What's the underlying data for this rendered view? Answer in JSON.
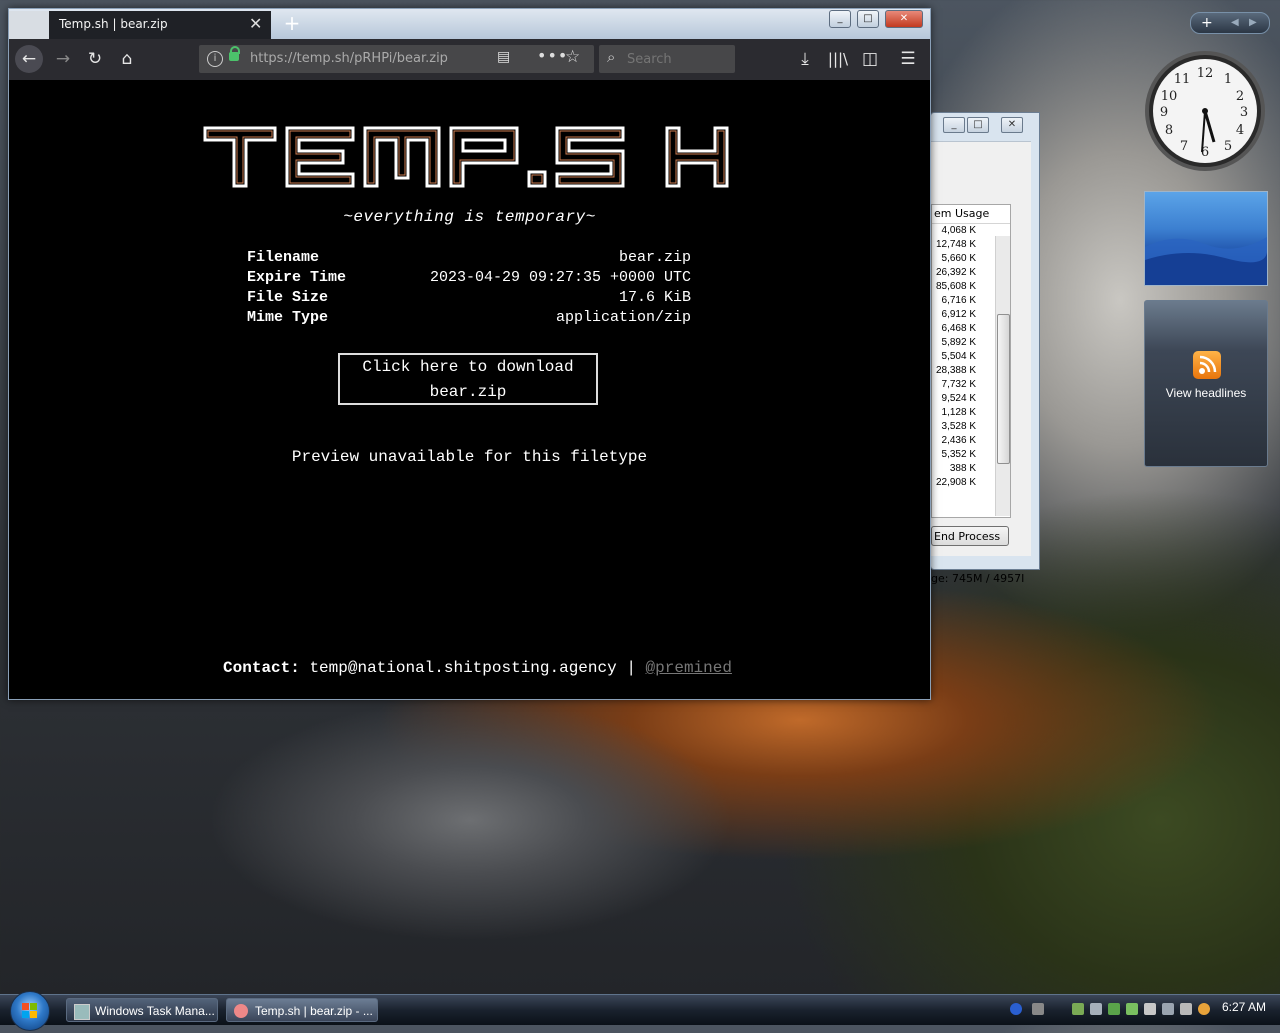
{
  "browser": {
    "tab_title": "Temp.sh | bear.zip",
    "new_tab_symbol": "+",
    "url_host": "https://temp.sh",
    "url_path": "/pRHPi/bear.zip",
    "search_placeholder": "Search"
  },
  "page": {
    "logo_text": "TEMP.SH",
    "tagline": "~everything is temporary~",
    "meta": [
      {
        "key": "Filename",
        "value": "bear.zip"
      },
      {
        "key": "Expire Time",
        "value": "2023-04-29 09:27:35 +0000 UTC"
      },
      {
        "key": "File Size",
        "value": "17.6 KiB"
      },
      {
        "key": "Mime Type",
        "value": "application/zip"
      }
    ],
    "download_line1": "Click here to download",
    "download_line2": "bear.zip",
    "preview": "Preview unavailable for this filetype",
    "contact_label": "Contact:",
    "contact_email": "temp@national.shitposting.agency",
    "contact_sep": "|",
    "contact_handle": "@premined"
  },
  "task_manager": {
    "column_header": "em Usage",
    "rows": [
      "4,068 K",
      "12,748 K",
      "5,660 K",
      "26,392 K",
      "85,608 K",
      "6,716 K",
      "6,912 K",
      "6,468 K",
      "5,892 K",
      "5,504 K",
      "28,388 K",
      "7,732 K",
      "9,524 K",
      "1,128 K",
      "3,528 K",
      "2,436 K",
      "5,352 K",
      "388 K",
      "22,908 K"
    ],
    "end_process": "End Process",
    "status": "ge: 745M / 4957I"
  },
  "gadgets": {
    "headlines": "View headlines"
  },
  "taskbar": {
    "task1": "Windows Task Mana...",
    "task2": "Temp.sh | bear.zip - ...",
    "time": "6:27 AM"
  },
  "colors": {
    "page_bg": "#000000",
    "page_text": "#ffffff",
    "lock_green": "#4cc26b",
    "close_red": "#c23a1f"
  }
}
